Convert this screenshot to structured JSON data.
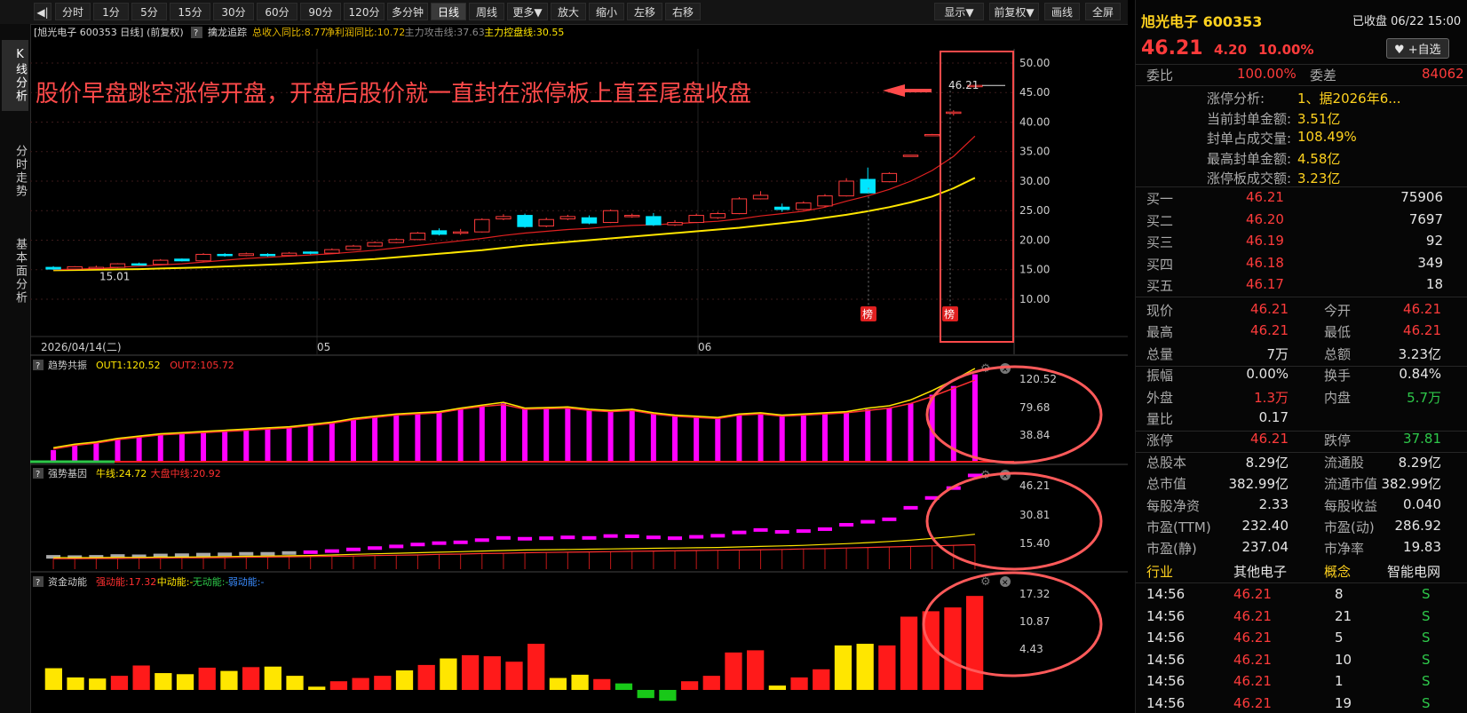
{
  "toolbar": {
    "buttons": [
      "分时",
      "1分",
      "5分",
      "15分",
      "30分",
      "60分",
      "90分",
      "120分",
      "多分钟",
      "日线",
      "周线",
      "更多▼",
      "放大",
      "缩小",
      "左移",
      "右移"
    ],
    "right_buttons": [
      "显示▼",
      "前复权▼",
      "画线",
      "全屏"
    ]
  },
  "left_tabs": [
    "K线分析",
    "分时走势",
    "基本面分析"
  ],
  "main_header": {
    "stock": "[旭光电子 600353 日线]",
    "fq": "(前复权)",
    "indicator": "擒龙追踪",
    "items": [
      {
        "text": "总收入同比:8.77",
        "color": "#e6b800"
      },
      {
        "text": "净利润同比:10.72",
        "color": "#e6b800"
      },
      {
        "text": "主力攻击线:37.63",
        "color": "#888888"
      },
      {
        "text": "主力控盘线:30.55",
        "color": "#ffe600"
      }
    ]
  },
  "annotation": "股价早盘跳空涨停开盘，开盘后股价就一直封在涨停板上直至尾盘收盘",
  "badge": "榜",
  "main_chart": {
    "y_ticks": [
      "50.00",
      "45.00",
      "40.00",
      "35.00",
      "30.00",
      "25.00",
      "20.00",
      "15.00",
      "10.00"
    ],
    "min_label": "15.01",
    "max_label": "46.21",
    "date_labels": [
      "2026/04/14(二)",
      "05",
      "06"
    ]
  },
  "panels": [
    {
      "name": "趋势共振",
      "items": [
        {
          "text": "OUT1:120.52",
          "color": "#ffe600"
        },
        {
          "text": "OUT2:105.72",
          "color": "#ff3030"
        }
      ],
      "ticks": [
        "120.52",
        "79.68",
        "38.84"
      ]
    },
    {
      "name": "强势基因",
      "items": [
        {
          "text": "牛线:24.72",
          "color": "#ffe600"
        },
        {
          "text": "大盘中线:20.92",
          "color": "#ff3030"
        }
      ],
      "ticks": [
        "46.21",
        "30.81",
        "15.40"
      ]
    },
    {
      "name": "资金动能",
      "items": [
        {
          "text": "强动能:17.32",
          "color": "#ff3030"
        },
        {
          "text": "中动能:-",
          "color": "#ffe600"
        },
        {
          "text": "无动能:-",
          "color": "#2ec84a"
        },
        {
          "text": "弱动能:-",
          "color": "#3a8cff"
        }
      ],
      "ticks": [
        "17.32",
        "10.87",
        "4.43"
      ]
    }
  ],
  "chart_data": {
    "type": "candlestick",
    "candles": [
      {
        "o": 15.4,
        "c": 15.1,
        "h": 15.6,
        "l": 15.0
      },
      {
        "o": 15.1,
        "c": 15.5,
        "h": 15.6,
        "l": 15.01
      },
      {
        "o": 15.2,
        "c": 15.4,
        "h": 15.7,
        "l": 15.1
      },
      {
        "o": 15.4,
        "c": 16.0,
        "h": 16.1,
        "l": 15.3
      },
      {
        "o": 16.0,
        "c": 15.8,
        "h": 16.2,
        "l": 15.7
      },
      {
        "o": 15.9,
        "c": 16.6,
        "h": 16.8,
        "l": 15.8
      },
      {
        "o": 16.8,
        "c": 16.5,
        "h": 16.9,
        "l": 16.4
      },
      {
        "o": 16.5,
        "c": 17.6,
        "h": 17.8,
        "l": 16.4
      },
      {
        "o": 17.6,
        "c": 17.4,
        "h": 17.8,
        "l": 17.2
      },
      {
        "o": 17.4,
        "c": 17.7,
        "h": 17.9,
        "l": 17.3
      },
      {
        "o": 17.6,
        "c": 17.4,
        "h": 17.8,
        "l": 17.2
      },
      {
        "o": 17.4,
        "c": 17.8,
        "h": 18.0,
        "l": 17.3
      },
      {
        "o": 18.0,
        "c": 17.8,
        "h": 18.1,
        "l": 17.6
      },
      {
        "o": 17.8,
        "c": 18.4,
        "h": 18.6,
        "l": 17.7
      },
      {
        "o": 18.4,
        "c": 19.0,
        "h": 19.2,
        "l": 18.3
      },
      {
        "o": 19.0,
        "c": 19.6,
        "h": 19.8,
        "l": 18.9
      },
      {
        "o": 19.6,
        "c": 20.1,
        "h": 20.3,
        "l": 19.5
      },
      {
        "o": 20.1,
        "c": 21.2,
        "h": 21.4,
        "l": 20.0
      },
      {
        "o": 21.6,
        "c": 21.0,
        "h": 22.0,
        "l": 20.8
      },
      {
        "o": 21.2,
        "c": 21.4,
        "h": 21.9,
        "l": 20.9
      },
      {
        "o": 21.4,
        "c": 23.5,
        "h": 23.7,
        "l": 21.3
      },
      {
        "o": 23.6,
        "c": 24.0,
        "h": 24.4,
        "l": 23.4
      },
      {
        "o": 24.2,
        "c": 22.3,
        "h": 24.5,
        "l": 22.1
      },
      {
        "o": 22.4,
        "c": 23.5,
        "h": 23.8,
        "l": 22.2
      },
      {
        "o": 23.6,
        "c": 24.0,
        "h": 24.3,
        "l": 23.4
      },
      {
        "o": 23.8,
        "c": 22.9,
        "h": 24.2,
        "l": 22.7
      },
      {
        "o": 23.0,
        "c": 25.0,
        "h": 25.2,
        "l": 22.9
      },
      {
        "o": 24.0,
        "c": 24.2,
        "h": 24.5,
        "l": 23.8
      },
      {
        "o": 24.0,
        "c": 22.6,
        "h": 24.6,
        "l": 22.4
      },
      {
        "o": 22.6,
        "c": 23.0,
        "h": 23.4,
        "l": 22.4
      },
      {
        "o": 23.0,
        "c": 24.2,
        "h": 24.5,
        "l": 22.9
      },
      {
        "o": 23.8,
        "c": 24.5,
        "h": 24.8,
        "l": 23.6
      },
      {
        "o": 24.5,
        "c": 27.0,
        "h": 27.3,
        "l": 24.4
      },
      {
        "o": 27.0,
        "c": 27.6,
        "h": 28.3,
        "l": 26.9
      },
      {
        "o": 25.6,
        "c": 25.2,
        "h": 26.2,
        "l": 24.8
      },
      {
        "o": 25.2,
        "c": 26.3,
        "h": 26.6,
        "l": 25.1
      },
      {
        "o": 25.8,
        "c": 27.5,
        "h": 27.8,
        "l": 25.6
      },
      {
        "o": 27.5,
        "c": 30.0,
        "h": 30.5,
        "l": 27.4
      },
      {
        "o": 30.3,
        "c": 28.0,
        "h": 32.3,
        "l": 27.9
      },
      {
        "o": 29.9,
        "c": 31.3,
        "h": 31.5,
        "l": 29.8
      },
      {
        "o": 34.4,
        "c": 34.4,
        "h": 34.4,
        "l": 34.4
      },
      {
        "o": 37.9,
        "c": 37.9,
        "h": 38.0,
        "l": 37.8
      },
      {
        "o": 41.5,
        "c": 41.7,
        "h": 42.0,
        "l": 41.1
      },
      {
        "o": 46.21,
        "c": 46.21,
        "h": 46.21,
        "l": 46.21
      }
    ],
    "ma_red": [
      15.0,
      15.1,
      15.2,
      15.4,
      15.6,
      15.8,
      16.0,
      16.3,
      16.6,
      16.9,
      17.1,
      17.3,
      17.5,
      17.7,
      18.0,
      18.3,
      18.7,
      19.1,
      19.5,
      19.9,
      20.3,
      20.8,
      21.2,
      21.5,
      21.8,
      22.0,
      22.3,
      22.5,
      22.6,
      22.8,
      23.0,
      23.2,
      23.6,
      24.1,
      24.5,
      24.9,
      25.6,
      26.6,
      27.5,
      28.6,
      30.0,
      31.8,
      34.2,
      37.63
    ],
    "ma_yellow": [
      14.9,
      14.95,
      15.0,
      15.05,
      15.1,
      15.2,
      15.3,
      15.4,
      15.55,
      15.7,
      15.85,
      16.0,
      16.2,
      16.4,
      16.6,
      16.8,
      17.1,
      17.4,
      17.7,
      18.0,
      18.3,
      18.7,
      19.1,
      19.4,
      19.7,
      20.0,
      20.3,
      20.6,
      20.9,
      21.2,
      21.5,
      21.8,
      22.1,
      22.5,
      22.9,
      23.3,
      23.8,
      24.3,
      24.9,
      25.6,
      26.4,
      27.4,
      28.8,
      30.55
    ],
    "trend_bars": [
      20,
      28,
      32,
      38,
      42,
      46,
      48,
      50,
      52,
      54,
      56,
      58,
      62,
      66,
      72,
      76,
      80,
      82,
      84,
      90,
      95,
      100,
      90,
      91,
      92,
      88,
      86,
      88,
      82,
      78,
      76,
      74,
      80,
      82,
      78,
      80,
      82,
      84,
      90,
      92,
      100,
      115,
      130,
      150
    ],
    "trend_out1": [
      24,
      30,
      34,
      40,
      44,
      48,
      50,
      52,
      54,
      56,
      58,
      60,
      64,
      68,
      74,
      78,
      82,
      84,
      86,
      92,
      97,
      102,
      92,
      93,
      94,
      90,
      88,
      90,
      84,
      80,
      78,
      76,
      82,
      84,
      80,
      82,
      84,
      86,
      92,
      96,
      106,
      122,
      140,
      160
    ],
    "trend_out2": [
      22,
      28,
      32,
      38,
      42,
      46,
      48,
      50,
      52,
      54,
      56,
      58,
      62,
      66,
      72,
      76,
      80,
      82,
      84,
      90,
      95,
      98,
      90,
      91,
      92,
      88,
      86,
      88,
      82,
      78,
      76,
      74,
      80,
      82,
      78,
      80,
      82,
      84,
      88,
      92,
      100,
      112,
      126,
      140
    ],
    "gene_values": [
      0,
      0,
      0,
      0,
      0,
      0,
      0,
      0,
      0,
      0,
      0,
      0,
      0,
      0,
      0,
      0,
      0,
      0,
      0,
      0,
      0,
      0,
      0,
      0,
      0,
      0,
      0,
      0,
      0,
      0,
      0,
      0,
      0,
      0,
      0,
      0,
      0,
      0,
      0,
      0,
      0,
      0,
      0,
      0
    ],
    "gene_boxes": [
      16.5,
      16.4,
      16.5,
      16.8,
      16.7,
      17.0,
      17.1,
      17.3,
      17.4,
      17.6,
      17.6,
      17.9,
      18.2,
      18.6,
      19.2,
      19.7,
      20.3,
      21.0,
      21.5,
      21.8,
      22.6,
      23.4,
      23.1,
      23.3,
      23.6,
      23.4,
      24.1,
      24.0,
      23.6,
      23.3,
      23.8,
      24.2,
      25.4,
      26.3,
      25.6,
      25.9,
      26.6,
      28.2,
      29.3,
      30.2,
      34.4,
      38.0,
      41.6,
      46.2
    ],
    "gene_yellow": [
      16.2,
      16.2,
      16.2,
      16.3,
      16.3,
      16.4,
      16.4,
      16.5,
      16.6,
      16.7,
      16.8,
      16.9,
      17.0,
      17.2,
      17.4,
      17.6,
      17.8,
      18.0,
      18.2,
      18.4,
      18.6,
      18.8,
      19.0,
      19.1,
      19.2,
      19.3,
      19.4,
      19.5,
      19.6,
      19.7,
      19.8,
      19.9,
      20.1,
      20.3,
      20.5,
      20.7,
      21.0,
      21.3,
      21.7,
      22.1,
      22.6,
      23.2,
      23.9,
      24.72
    ],
    "gene_red": [
      15.8,
      15.8,
      15.9,
      15.9,
      16.0,
      16.0,
      16.1,
      16.1,
      16.2,
      16.3,
      16.4,
      16.5,
      16.6,
      16.7,
      16.8,
      17.0,
      17.1,
      17.2,
      17.4,
      17.5,
      17.7,
      17.8,
      18.0,
      18.1,
      18.2,
      18.3,
      18.4,
      18.5,
      18.6,
      18.7,
      18.8,
      18.9,
      19.0,
      19.1,
      19.2,
      19.4,
      19.5,
      19.7,
      19.9,
      20.1,
      20.3,
      20.5,
      20.7,
      20.92
    ],
    "fund_values": [
      4.0,
      2.3,
      2.1,
      2.6,
      4.5,
      3.1,
      2.9,
      4.1,
      3.5,
      4.2,
      4.3,
      2.6,
      0.6,
      1.6,
      2.2,
      2.6,
      3.6,
      4.6,
      5.8,
      6.4,
      6.2,
      5.2,
      8.5,
      2.2,
      2.8,
      2.0,
      1.2,
      -1.5,
      -2.0,
      1.6,
      2.6,
      6.9,
      7.3,
      0.8,
      2.3,
      3.8,
      8.2,
      8.5,
      8.2,
      13.5,
      14.5,
      15.2,
      17.32
    ],
    "fund_colors": [
      "y",
      "y",
      "y",
      "r",
      "r",
      "y",
      "y",
      "r",
      "y",
      "r",
      "y",
      "y",
      "y",
      "r",
      "r",
      "r",
      "y",
      "r",
      "y",
      "r",
      "r",
      "r",
      "r",
      "y",
      "y",
      "r",
      "g",
      "g",
      "g",
      "r",
      "r",
      "r",
      "r",
      "y",
      "r",
      "r",
      "y",
      "y",
      "r",
      "r",
      "r",
      "r",
      "r"
    ]
  },
  "right_panel": {
    "title": "旭光电子 600353",
    "status": "已收盘 06/22 15:00",
    "price": "46.21",
    "change": "4.20",
    "pct": "10.00%",
    "fav": "+自选",
    "wei_bi_label": "委比",
    "wei_bi": "100.00%",
    "wei_cha_label": "委差",
    "wei_cha": "84062",
    "limit_analysis": [
      {
        "label": "涨停分析:",
        "value": "1、据2026年6..."
      },
      {
        "label": "当前封单金额:",
        "value": "3.51亿"
      },
      {
        "label": "封单占成交量:",
        "value": "108.49%"
      },
      {
        "label": "最高封单金额:",
        "value": "4.58亿"
      },
      {
        "label": "涨停板成交额:",
        "value": "3.23亿"
      }
    ],
    "bids": [
      {
        "label": "买一",
        "price": "46.21",
        "vol": "75906"
      },
      {
        "label": "买二",
        "price": "46.20",
        "vol": "7697"
      },
      {
        "label": "买三",
        "price": "46.19",
        "vol": "92"
      },
      {
        "label": "买四",
        "price": "46.18",
        "vol": "349"
      },
      {
        "label": "买五",
        "price": "46.17",
        "vol": "18"
      }
    ],
    "quote_rows": [
      [
        {
          "t": "现价",
          "c": "gray"
        },
        {
          "t": "46.21",
          "c": "red"
        },
        {
          "t": "今开",
          "c": "gray"
        },
        {
          "t": "46.21",
          "c": "red"
        }
      ],
      [
        {
          "t": "最高",
          "c": "gray"
        },
        {
          "t": "46.21",
          "c": "red"
        },
        {
          "t": "最低",
          "c": "gray"
        },
        {
          "t": "46.21",
          "c": "red"
        }
      ],
      [
        {
          "t": "总量",
          "c": "gray"
        },
        {
          "t": "7万",
          "c": "white"
        },
        {
          "t": "总额",
          "c": "gray"
        },
        {
          "t": "3.23亿",
          "c": "white"
        }
      ],
      [
        {
          "t": "振幅",
          "c": "gray"
        },
        {
          "t": "0.00%",
          "c": "white"
        },
        {
          "t": "换手",
          "c": "gray"
        },
        {
          "t": "0.84%",
          "c": "white"
        }
      ],
      [
        {
          "t": "外盘",
          "c": "gray"
        },
        {
          "t": "1.3万",
          "c": "red"
        },
        {
          "t": "内盘",
          "c": "gray"
        },
        {
          "t": "5.7万",
          "c": "green"
        }
      ],
      [
        {
          "t": "量比",
          "c": "gray"
        },
        {
          "t": "0.17",
          "c": "white"
        },
        {
          "t": "",
          "c": "gray"
        },
        {
          "t": "",
          "c": "white"
        }
      ],
      [
        {
          "t": "涨停",
          "c": "gray"
        },
        {
          "t": "46.21",
          "c": "red"
        },
        {
          "t": "跌停",
          "c": "gray"
        },
        {
          "t": "37.81",
          "c": "green"
        }
      ],
      [
        {
          "t": "总股本",
          "c": "gray"
        },
        {
          "t": "8.29亿",
          "c": "white"
        },
        {
          "t": "流通股",
          "c": "gray"
        },
        {
          "t": "8.29亿",
          "c": "white"
        }
      ],
      [
        {
          "t": "总市值",
          "c": "gray"
        },
        {
          "t": "382.99亿",
          "c": "white"
        },
        {
          "t": "流通市值",
          "c": "gray"
        },
        {
          "t": "382.99亿",
          "c": "white"
        }
      ],
      [
        {
          "t": "每股净资",
          "c": "gray"
        },
        {
          "t": "2.33",
          "c": "white"
        },
        {
          "t": "每股收益",
          "c": "gray"
        },
        {
          "t": "0.040",
          "c": "white"
        }
      ],
      [
        {
          "t": "市盈(TTM)",
          "c": "gray"
        },
        {
          "t": "232.40",
          "c": "white"
        },
        {
          "t": "市盈(动)",
          "c": "gray"
        },
        {
          "t": "286.92",
          "c": "white"
        }
      ],
      [
        {
          "t": "市盈(静)",
          "c": "gray"
        },
        {
          "t": "237.04",
          "c": "white"
        },
        {
          "t": "市净率",
          "c": "gray"
        },
        {
          "t": "19.83",
          "c": "white"
        }
      ]
    ],
    "industry_row": [
      {
        "t": "行业",
        "c": "yellow"
      },
      {
        "t": "其他电子",
        "c": "white"
      },
      {
        "t": "概念",
        "c": "yellow"
      },
      {
        "t": "智能电网",
        "c": "white"
      }
    ],
    "ticks": [
      {
        "time": "14:56",
        "price": "46.21",
        "vol": "8",
        "dir": "S"
      },
      {
        "time": "14:56",
        "price": "46.21",
        "vol": "21",
        "dir": "S"
      },
      {
        "time": "14:56",
        "price": "46.21",
        "vol": "5",
        "dir": "S"
      },
      {
        "time": "14:56",
        "price": "46.21",
        "vol": "10",
        "dir": "S"
      },
      {
        "time": "14:56",
        "price": "46.21",
        "vol": "1",
        "dir": "S"
      },
      {
        "time": "14:56",
        "price": "46.21",
        "vol": "19",
        "dir": "S"
      }
    ]
  }
}
